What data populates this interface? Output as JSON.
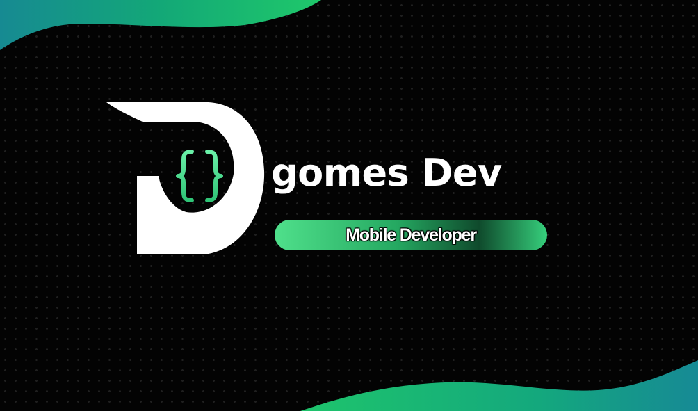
{
  "brand": {
    "title": "gomes Dev",
    "subtitle": "Mobile Developer",
    "logo_icon": "curly-braces-icon"
  },
  "colors": {
    "background": "#030303",
    "accent_green": "#3ddc84",
    "accent_teal": "#1a8a8a",
    "text": "#ffffff"
  }
}
